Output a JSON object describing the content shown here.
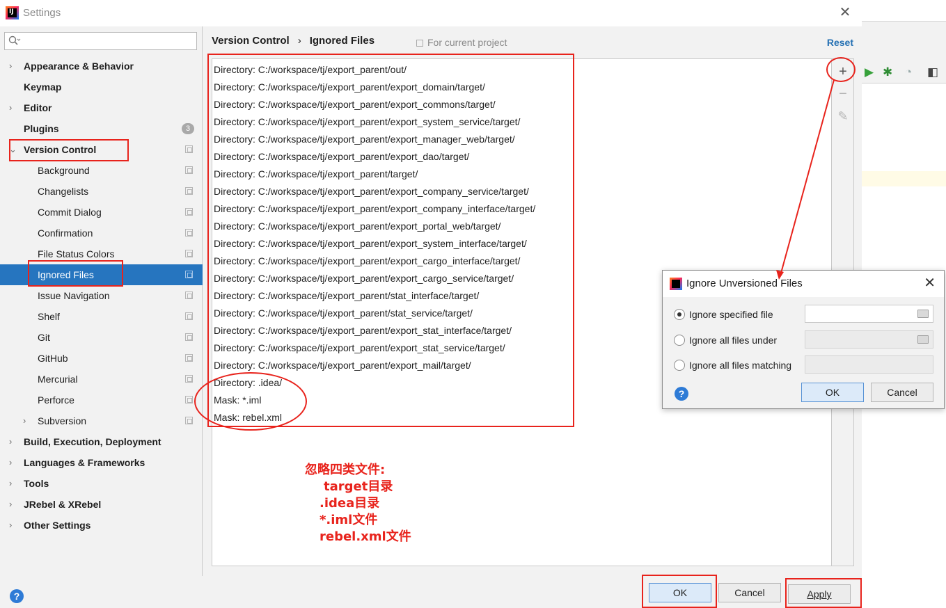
{
  "window": {
    "title": "Settings"
  },
  "sidebar": {
    "search_placeholder": "",
    "items": [
      {
        "label": "Appearance & Behavior",
        "level": 0,
        "expandable": true
      },
      {
        "label": "Keymap",
        "level": 0,
        "expandable": false
      },
      {
        "label": "Editor",
        "level": 0,
        "expandable": true
      },
      {
        "label": "Plugins",
        "level": 0,
        "expandable": false,
        "badge": "3"
      },
      {
        "label": "Version Control",
        "level": 0,
        "expanded": true
      },
      {
        "label": "Background",
        "level": 1
      },
      {
        "label": "Changelists",
        "level": 1
      },
      {
        "label": "Commit Dialog",
        "level": 1
      },
      {
        "label": "Confirmation",
        "level": 1
      },
      {
        "label": "File Status Colors",
        "level": 1
      },
      {
        "label": "Ignored Files",
        "level": 1,
        "selected": true
      },
      {
        "label": "Issue Navigation",
        "level": 1
      },
      {
        "label": "Shelf",
        "level": 1
      },
      {
        "label": "Git",
        "level": 1
      },
      {
        "label": "GitHub",
        "level": 1
      },
      {
        "label": "Mercurial",
        "level": 1
      },
      {
        "label": "Perforce",
        "level": 1
      },
      {
        "label": "Subversion",
        "level": 1,
        "expandable": true
      },
      {
        "label": "Build, Execution, Deployment",
        "level": 0,
        "expandable": true
      },
      {
        "label": "Languages & Frameworks",
        "level": 0,
        "expandable": true
      },
      {
        "label": "Tools",
        "level": 0,
        "expandable": true
      },
      {
        "label": "JRebel & XRebel",
        "level": 0,
        "expandable": true
      },
      {
        "label": "Other Settings",
        "level": 0,
        "expandable": true
      }
    ]
  },
  "header": {
    "crumb_parent": "Version Control",
    "crumb_separator": "›",
    "crumb_current": "Ignored Files",
    "scope": "For current project",
    "reset": "Reset"
  },
  "ignored": [
    "Directory: C:/workspace/tj/export_parent/out/",
    "Directory: C:/workspace/tj/export_parent/export_domain/target/",
    "Directory: C:/workspace/tj/export_parent/export_commons/target/",
    "Directory: C:/workspace/tj/export_parent/export_system_service/target/",
    "Directory: C:/workspace/tj/export_parent/export_manager_web/target/",
    "Directory: C:/workspace/tj/export_parent/export_dao/target/",
    "Directory: C:/workspace/tj/export_parent/target/",
    "Directory: C:/workspace/tj/export_parent/export_company_service/target/",
    "Directory: C:/workspace/tj/export_parent/export_company_interface/target/",
    "Directory: C:/workspace/tj/export_parent/export_portal_web/target/",
    "Directory: C:/workspace/tj/export_parent/export_system_interface/target/",
    "Directory: C:/workspace/tj/export_parent/export_cargo_interface/target/",
    "Directory: C:/workspace/tj/export_parent/export_cargo_service/target/",
    "Directory: C:/workspace/tj/export_parent/stat_interface/target/",
    "Directory: C:/workspace/tj/export_parent/stat_service/target/",
    "Directory: C:/workspace/tj/export_parent/export_stat_interface/target/",
    "Directory: C:/workspace/tj/export_parent/export_stat_service/target/",
    "Directory: C:/workspace/tj/export_parent/export_mail/target/",
    "Directory: .idea/",
    "Mask: *.iml",
    "Mask: rebel.xml"
  ],
  "toolbar": {
    "add": "+",
    "remove": "−",
    "edit": "✎"
  },
  "annotation": [
    "忽略四类文件:",
    "target目录",
    ".idea目录",
    "*.iml文件",
    "rebel.xml文件"
  ],
  "footer": {
    "help": "?",
    "ok": "OK",
    "cancel": "Cancel",
    "apply": "Apply"
  },
  "dialog": {
    "title": "Ignore Unversioned Files",
    "options": [
      {
        "label": "Ignore specified file",
        "selected": true,
        "field_value": ""
      },
      {
        "label": "Ignore all files under",
        "selected": false,
        "field_value": ""
      },
      {
        "label": "Ignore all files matching",
        "selected": false,
        "field_value": ""
      }
    ],
    "help": "?",
    "ok": "OK",
    "cancel": "Cancel"
  },
  "colors": {
    "accent": "#2675bf",
    "markup": "#e8231c",
    "link": "#2470b3"
  }
}
